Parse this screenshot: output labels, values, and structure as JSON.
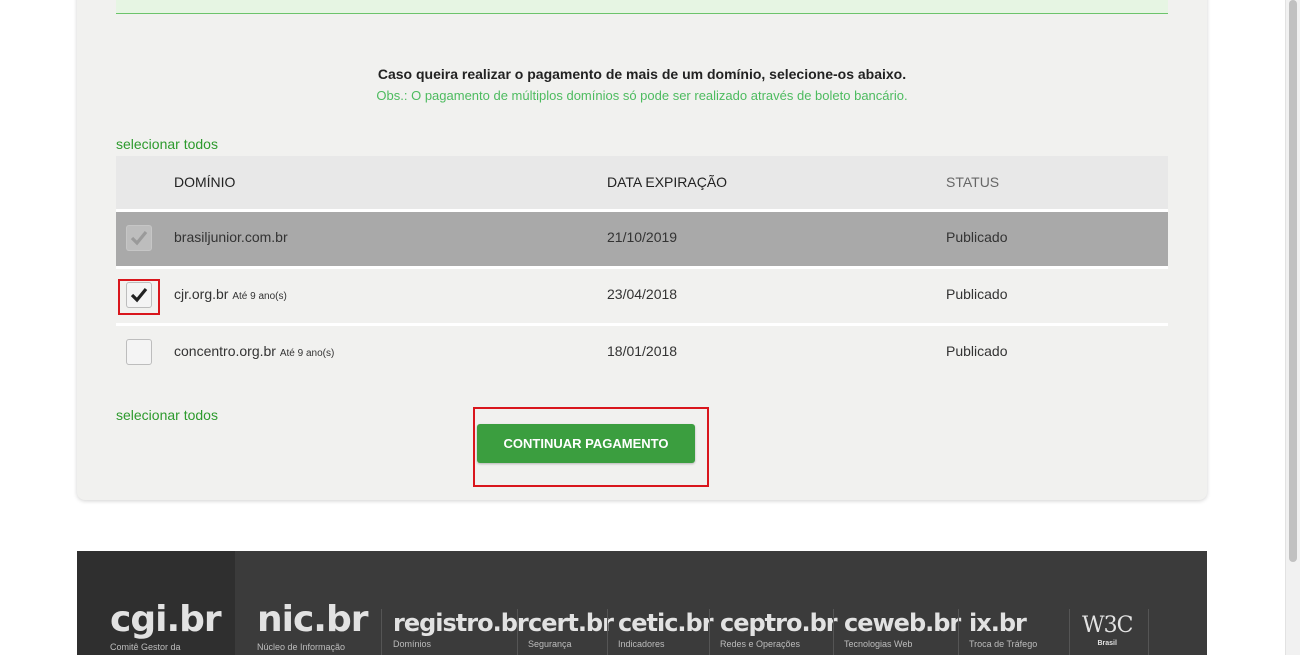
{
  "intro": {
    "headline": "Caso queira realizar o pagamento de mais de um domínio, selecione-os abaixo.",
    "note": "Obs.: O pagamento de múltiplos domínios só pode ser realizado através de boleto bancário."
  },
  "select_all_label": "selecionar todos",
  "table": {
    "headers": {
      "domain": "DOMÍNIO",
      "expiration": "DATA EXPIRAÇÃO",
      "status": "STATUS"
    },
    "rows": [
      {
        "domain": "brasiljunior.com.br",
        "hint": "",
        "expiration": "21/10/2019",
        "status": "Publicado",
        "checked": true,
        "disabled": true
      },
      {
        "domain": "cjr.org.br",
        "hint": "Até 9 ano(s)",
        "expiration": "23/04/2018",
        "status": "Publicado",
        "checked": true,
        "disabled": false
      },
      {
        "domain": "concentro.org.br",
        "hint": "Até 9 ano(s)",
        "expiration": "18/01/2018",
        "status": "Publicado",
        "checked": false,
        "disabled": false
      }
    ]
  },
  "continue_button": "CONTINUAR PAGAMENTO",
  "footer": {
    "logos": [
      {
        "name": "cgi.br",
        "caption": "Comitê Gestor da"
      },
      {
        "name": "nic.br",
        "caption": "Núcleo de Informação"
      },
      {
        "name": "registro.br",
        "caption": "Domínios"
      },
      {
        "name": "cert.br",
        "caption": "Segurança"
      },
      {
        "name": "cetic.br",
        "caption": "Indicadores"
      },
      {
        "name": "ceptro.br",
        "caption": "Redes e Operações"
      },
      {
        "name": "ceweb.br",
        "caption": "Tecnologias Web"
      },
      {
        "name": "ix.br",
        "caption": "Troca de Tráfego"
      },
      {
        "name": "W3C",
        "caption": "Brasil"
      }
    ]
  },
  "colors": {
    "accent_green": "#3b9e3f",
    "link_green": "#2d9a2d",
    "highlight_red": "#d9161c"
  }
}
